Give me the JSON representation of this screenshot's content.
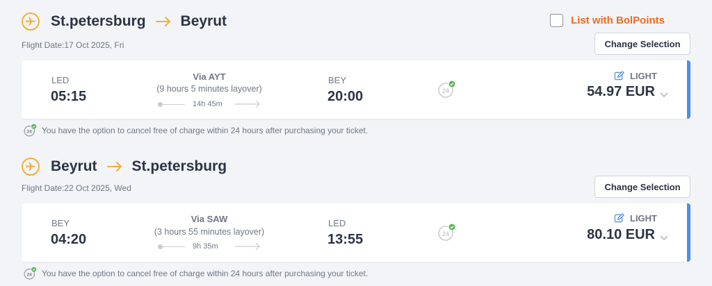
{
  "colors": {
    "accent": "#f2b134",
    "brand_orange": "#f06b22",
    "card_border": "#4b8fe8"
  },
  "bolpoints": {
    "label": "List with BolPoints",
    "checked": false
  },
  "change_label": "Change Selection",
  "legs": [
    {
      "from": "St.petersburg",
      "to": "Beyrut",
      "flight_date": "Flight Date:17 Oct 2025, Fri",
      "dep_code": "LED",
      "dep_time": "05:15",
      "via": "Via AYT",
      "layover": "(9 hours 5 minutes layover)",
      "duration": "14h 45m",
      "arr_code": "BEY",
      "arr_time": "20:00",
      "fare_type": "LIGHT",
      "price": "54.97 EUR",
      "cancel_note": "You have the option to cancel free of charge within 24 hours after purchasing your ticket."
    },
    {
      "from": "Beyrut",
      "to": "St.petersburg",
      "flight_date": "Flight Date:22 Oct 2025, Wed",
      "dep_code": "BEY",
      "dep_time": "04:20",
      "via": "Via SAW",
      "layover": "(3 hours 55 minutes layover)",
      "duration": "9h 35m",
      "arr_code": "LED",
      "arr_time": "13:55",
      "fare_type": "LIGHT",
      "price": "80.10 EUR",
      "cancel_note": "You have the option to cancel free of charge within 24 hours after purchasing your ticket."
    }
  ],
  "icons": [
    "airplane-icon",
    "arrow-right-icon",
    "24h-cancel-icon",
    "edit-icon",
    "chevron-down-icon"
  ]
}
